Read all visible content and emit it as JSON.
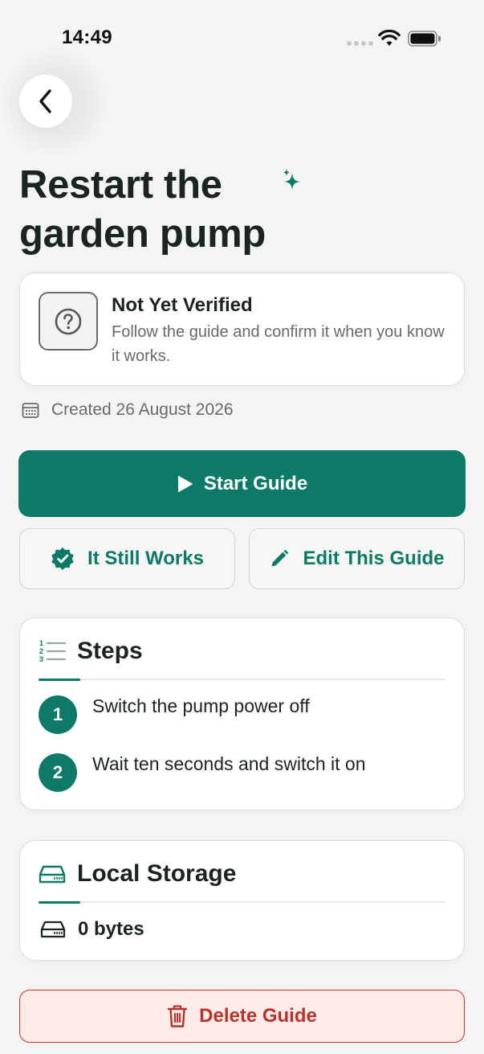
{
  "status_bar": {
    "time": "14:49"
  },
  "header": {
    "title": "Restart the garden pump"
  },
  "verification": {
    "title": "Not Yet Verified",
    "description": "Follow the guide and confirm it when you know it works."
  },
  "created": {
    "label": "Created 26 August 2026"
  },
  "actions": {
    "start_label": "Start Guide",
    "still_works_label": "It Still Works",
    "edit_label": "Edit This Guide",
    "delete_label": "Delete Guide"
  },
  "steps": {
    "title": "Steps",
    "items": [
      {
        "number": "1",
        "text": "Switch the pump power off"
      },
      {
        "number": "2",
        "text": "Wait ten seconds and switch it on"
      }
    ]
  },
  "storage": {
    "title": "Local Storage",
    "value": "0 bytes"
  },
  "colors": {
    "accent": "#0c7a66",
    "danger": "#b8322a",
    "danger_bg": "#fdebea",
    "background": "#f3f4f3"
  },
  "icons": {
    "back": "chevron-left-icon",
    "sparkle": "sparkle-icon",
    "question": "question-circle-icon",
    "calendar": "calendar-icon",
    "play": "play-icon",
    "verified": "verified-badge-icon",
    "edit": "pencil-icon",
    "steps": "numbered-list-icon",
    "storage": "drive-icon",
    "delete": "trash-icon"
  }
}
